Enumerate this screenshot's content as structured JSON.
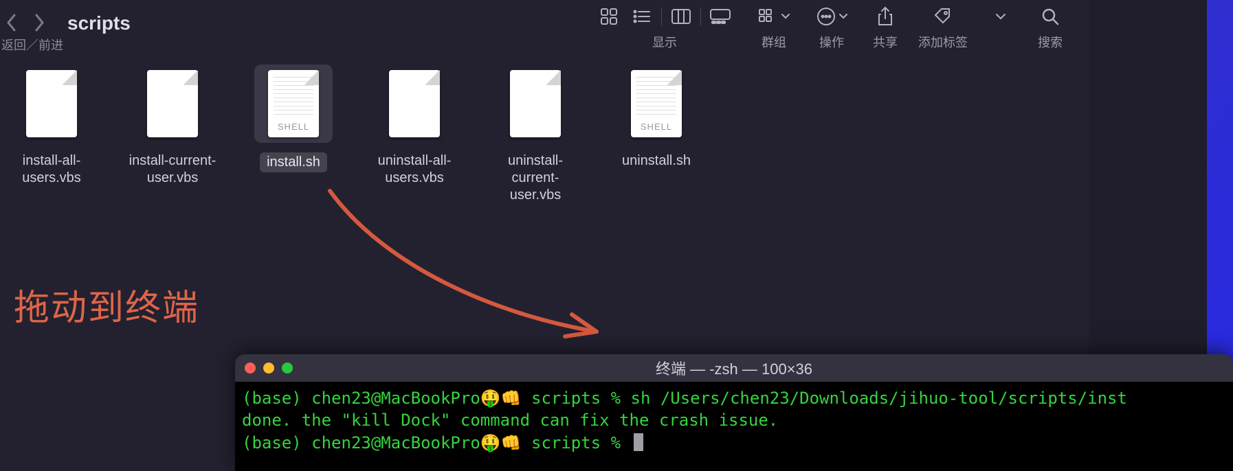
{
  "finder": {
    "folder_title": "scripts",
    "nav_sub_label": "返回／前进",
    "toolbar": {
      "view_label": "显示",
      "group_label": "群组",
      "action_label": "操作",
      "share_label": "共享",
      "tags_label": "添加标签",
      "search_label": "搜索"
    },
    "files": [
      {
        "name": "install-all-users.vbs",
        "type": "plain",
        "selected": false
      },
      {
        "name": "install-current-user.vbs",
        "type": "plain",
        "selected": false
      },
      {
        "name": "install.sh",
        "type": "shell",
        "selected": true
      },
      {
        "name": "uninstall-all-users.vbs",
        "type": "plain",
        "selected": false
      },
      {
        "name": "uninstall-current-user.vbs",
        "type": "plain",
        "selected": false
      },
      {
        "name": "uninstall.sh",
        "type": "shell",
        "selected": false
      }
    ],
    "shell_badge": "SHELL"
  },
  "annotation": {
    "text": "拖动到终端",
    "arrow_color": "#d5593f"
  },
  "terminal": {
    "title": "终端 — -zsh — 100×36",
    "lines": [
      "(base) chen23@MacBookPro🤑👊 scripts % sh /Users/chen23/Downloads/jihuo-tool/scripts/inst",
      "done. the \"kill Dock\" command can fix the crash issue.",
      "(base) chen23@MacBookPro🤑👊 scripts % "
    ]
  }
}
